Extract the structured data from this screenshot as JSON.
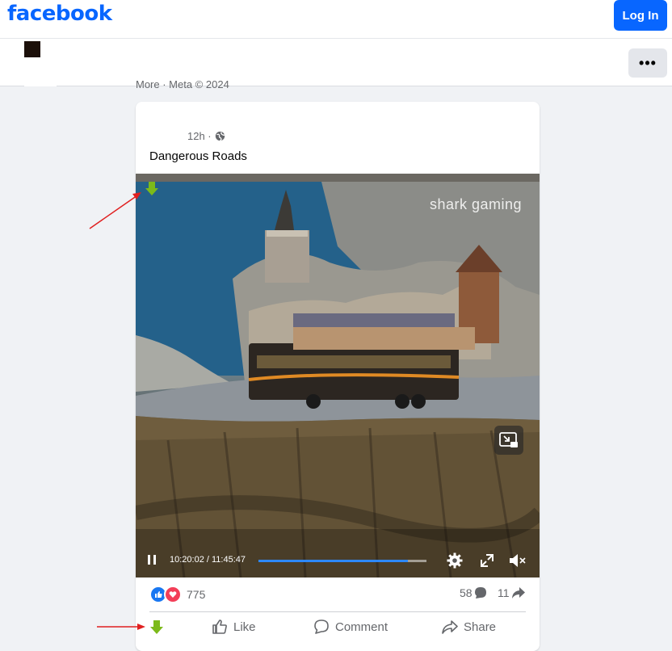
{
  "header": {
    "logo": "facebook",
    "login_label": "Log In",
    "more_label": "•••"
  },
  "footer_links": "More · Meta © 2024",
  "post": {
    "time": "12h ·",
    "title": "Dangerous Roads",
    "video": {
      "watermark": "shark  gaming",
      "time_display": "10:20:02 / 11:45:47",
      "progress_fraction": 0.889
    },
    "stats": {
      "reactions_count": "775",
      "comments_count": "58",
      "shares_count": "11"
    },
    "actions": {
      "like": "Like",
      "comment": "Comment",
      "share": "Share"
    }
  },
  "colors": {
    "brand": "#0866ff",
    "annotation_arrow": "#e02020",
    "download_arrow": "#7cba1a"
  }
}
